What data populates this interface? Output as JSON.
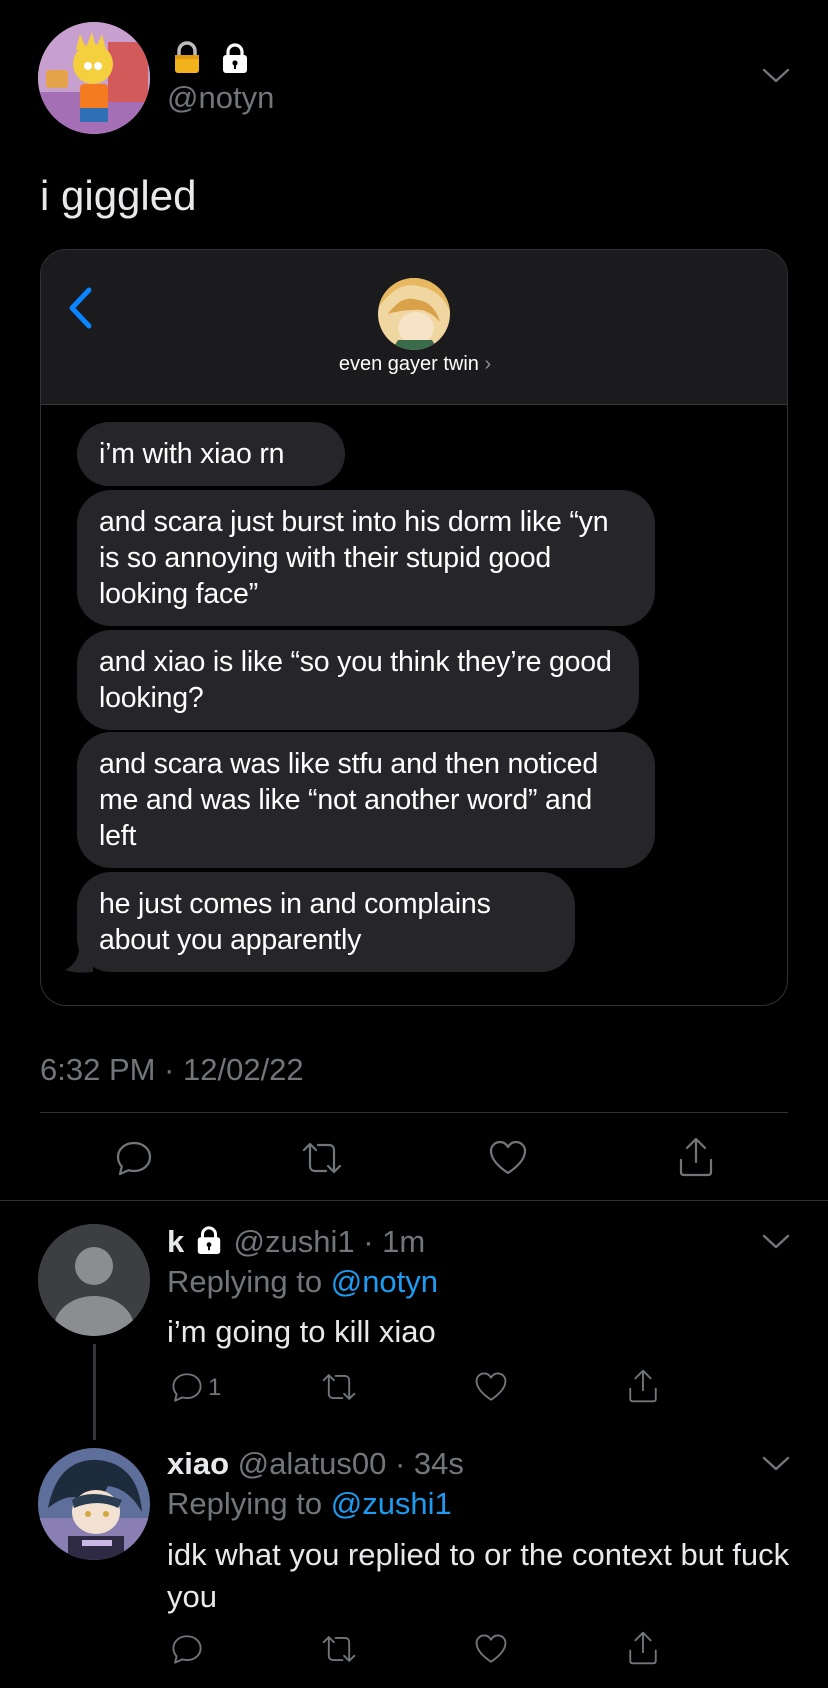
{
  "main_tweet": {
    "handle": "@notyn",
    "lock_emoji": "🔒",
    "text": "i giggled",
    "timestamp": "6:32 PM · 12/02/22"
  },
  "imessage": {
    "contact_name": "even gayer twin",
    "messages": [
      "i’m with xiao rn",
      "and scara just burst into his dorm like “yn is so annoying with their stupid good looking face”",
      "and xiao is like “so you think they’re good looking?",
      "and scara was like stfu and then noticed me and was like “not another word” and left",
      "he just comes in and complains about you apparently"
    ]
  },
  "reply1": {
    "name": "k",
    "handle": "@zushi1",
    "time": "1m",
    "replying_label": "Replying to",
    "replying_to": "@notyn",
    "text": "i’m going to kill xiao",
    "reply_count": "1"
  },
  "reply2": {
    "name": "xiao",
    "handle": "@alatus00",
    "time": "34s",
    "replying_label": "Replying to",
    "replying_to": "@zushi1",
    "text": "idk what you replied to or the context but fuck you"
  },
  "colors": {
    "accent": "#1d9bf0",
    "bubble": "#26252a",
    "muted": "#71767b"
  },
  "icons": [
    "chevron-down-icon",
    "lock-icon",
    "back-chevron-icon",
    "reply-icon",
    "retweet-icon",
    "like-icon",
    "share-icon"
  ]
}
